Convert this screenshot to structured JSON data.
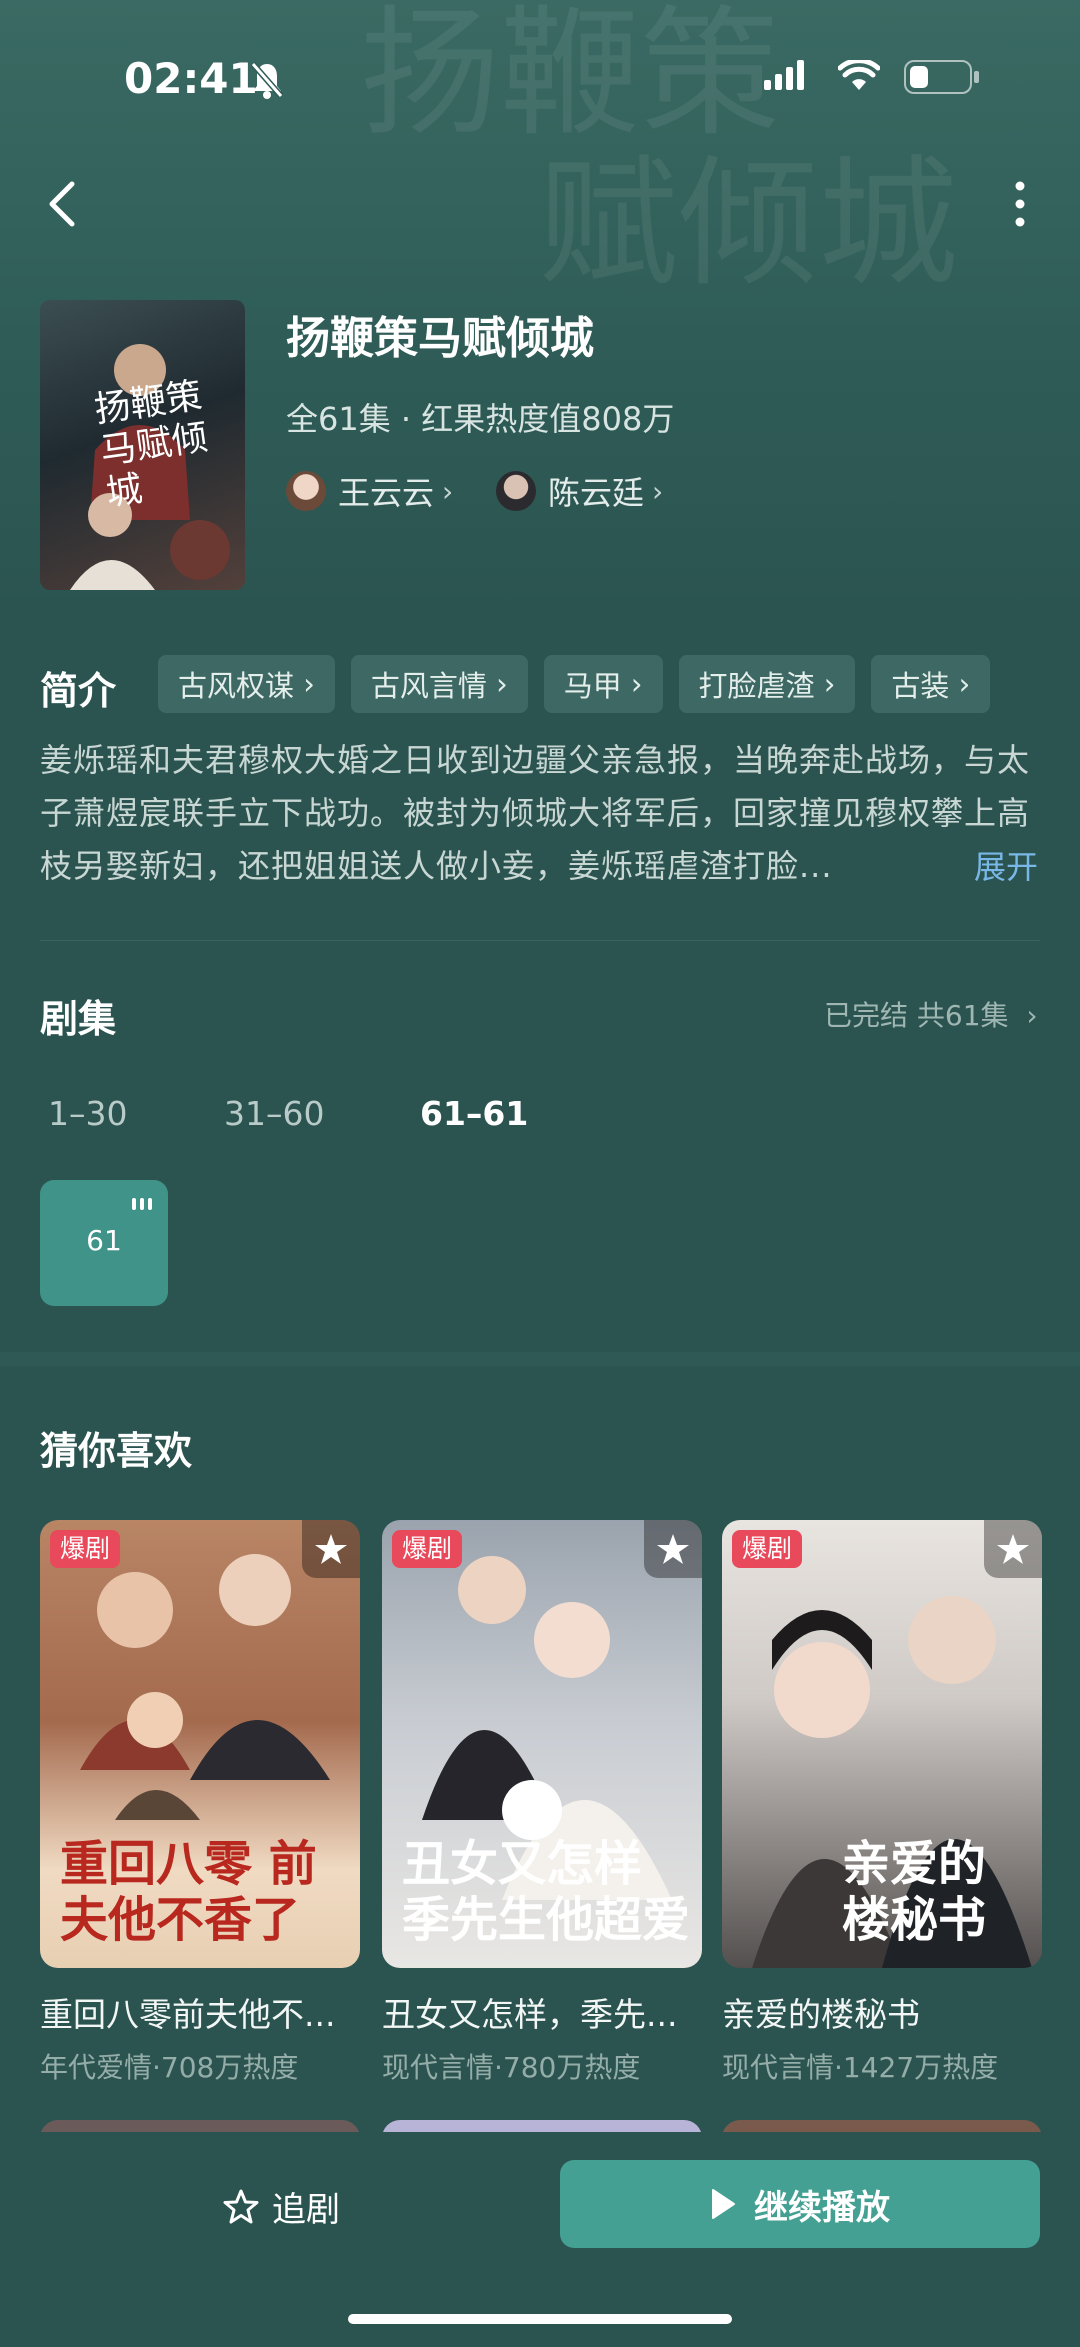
{
  "status_bar": {
    "time": "02:41"
  },
  "drama": {
    "title": "扬鞭策马赋倾城",
    "meta": "全61集 · 红果热度值808万",
    "poster_title": "扬鞭策马赋倾城",
    "actors": [
      {
        "name": "王云云"
      },
      {
        "name": "陈云廷"
      }
    ]
  },
  "intro": {
    "heading": "简介",
    "tags": [
      "古风权谋",
      "古风言情",
      "马甲",
      "打脸虐渣",
      "古装"
    ],
    "text": "姜烁瑶和夫君穆权大婚之日收到边疆父亲急报，当晚奔赴战场，与太子萧煜宸联手立下战功。被封为倾城大将军后，回家撞见穆权攀上高枝另娶新妇，还把姐姐送人做小妾，姜烁瑶虐渣打脸...",
    "expand_label": "展开"
  },
  "episodes": {
    "heading": "剧集",
    "status": "已完结 共61集",
    "ranges": [
      "1–30",
      "31–60",
      "61–61"
    ],
    "active_range": 2,
    "tiles": [
      "61"
    ]
  },
  "recommend": {
    "heading": "猜你喜欢",
    "items": [
      {
        "badge": "爆剧",
        "cover_text": "重回八零 前夫他不香了",
        "name": "重回八零前夫他不...",
        "info": "年代爱情·708万热度"
      },
      {
        "badge": "爆剧",
        "cover_text": "丑女又怎样 季先生他超爱",
        "name": "丑女又怎样，季先...",
        "info": "现代言情·780万热度"
      },
      {
        "badge": "爆剧",
        "cover_text": "亲爱的楼秘书",
        "name": "亲爱的楼秘书",
        "info": "现代言情·1427万热度"
      }
    ]
  },
  "bottom_bar": {
    "follow_label": "追剧",
    "play_label": "继续播放"
  },
  "colors": {
    "background": "#2b5450",
    "accent": "#44a093",
    "badge": "#e8495b",
    "link": "#79b7e6"
  }
}
